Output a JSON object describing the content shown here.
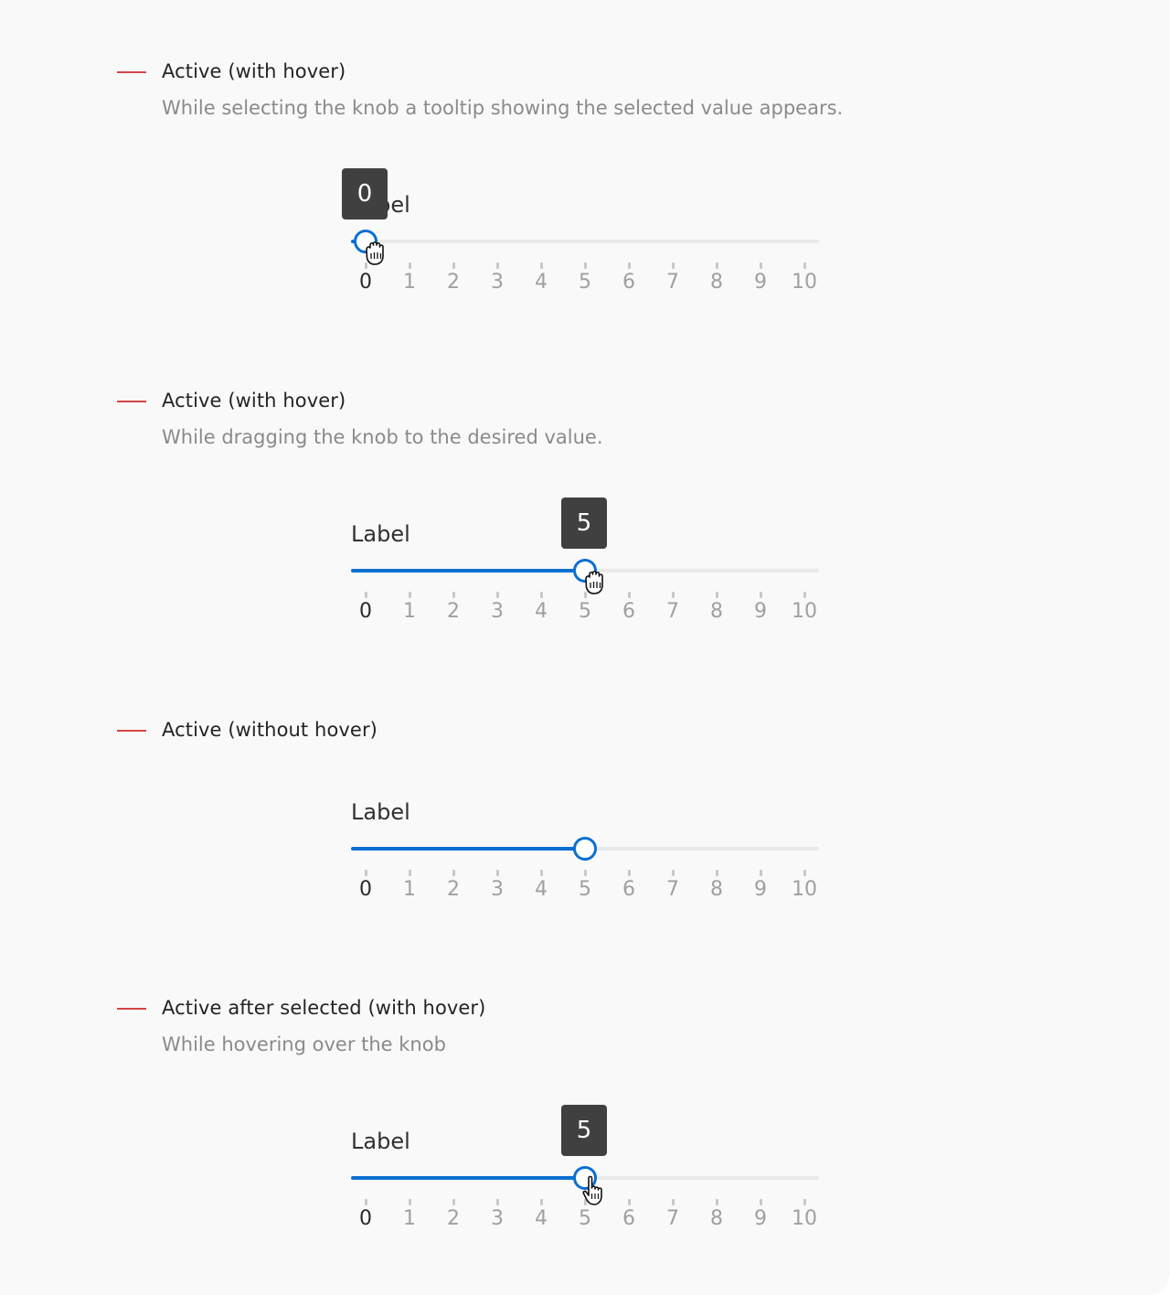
{
  "sections": [
    {
      "title": "Active (with hover)",
      "description": "While selecting the knob a tooltip showing the selected value appears.",
      "slider": {
        "label": "Label",
        "value": 0,
        "tooltip": "0",
        "show_tooltip": true,
        "cursor": "grab-hand-icon"
      }
    },
    {
      "title": "Active (with hover)",
      "description": "While dragging the knob to the desired value.",
      "slider": {
        "label": "Label",
        "value": 5,
        "tooltip": "5",
        "show_tooltip": true,
        "cursor": "grab-hand-icon"
      }
    },
    {
      "title": "Active (without hover)",
      "description": "",
      "slider": {
        "label": "Label",
        "value": 5,
        "tooltip": "",
        "show_tooltip": false,
        "cursor": ""
      }
    },
    {
      "title": "Active after selected (with hover)",
      "description": "While hovering over the knob",
      "slider": {
        "label": "Label",
        "value": 5,
        "tooltip": "5",
        "show_tooltip": true,
        "cursor": "pointer-hand-icon"
      }
    }
  ],
  "scale": {
    "min": 0,
    "max": 10,
    "ticks": [
      "0",
      "1",
      "2",
      "3",
      "4",
      "5",
      "6",
      "7",
      "8",
      "9",
      "10"
    ]
  },
  "colors": {
    "accent": "#0a6fd1",
    "marker": "#d64545",
    "tooltip": "#404040",
    "track": "#e9e9e9"
  }
}
